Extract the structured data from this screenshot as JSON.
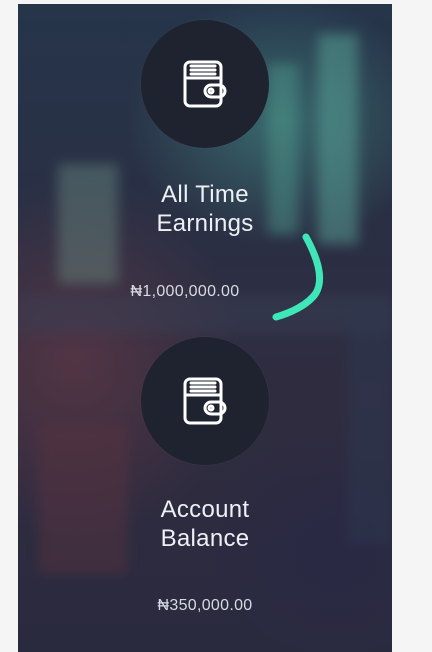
{
  "cards": [
    {
      "title_line1": "All Time",
      "title_line2": "Earnings",
      "amount": "₦1,000,000.00",
      "icon": "wallet-icon"
    },
    {
      "title_line1": "Account",
      "title_line2": "Balance",
      "amount": "₦350,000.00",
      "icon": "wallet-icon"
    }
  ],
  "colors": {
    "circle_bg": "#1f2330",
    "text": "#eef0f4",
    "annotation": "#3ee6b8"
  }
}
